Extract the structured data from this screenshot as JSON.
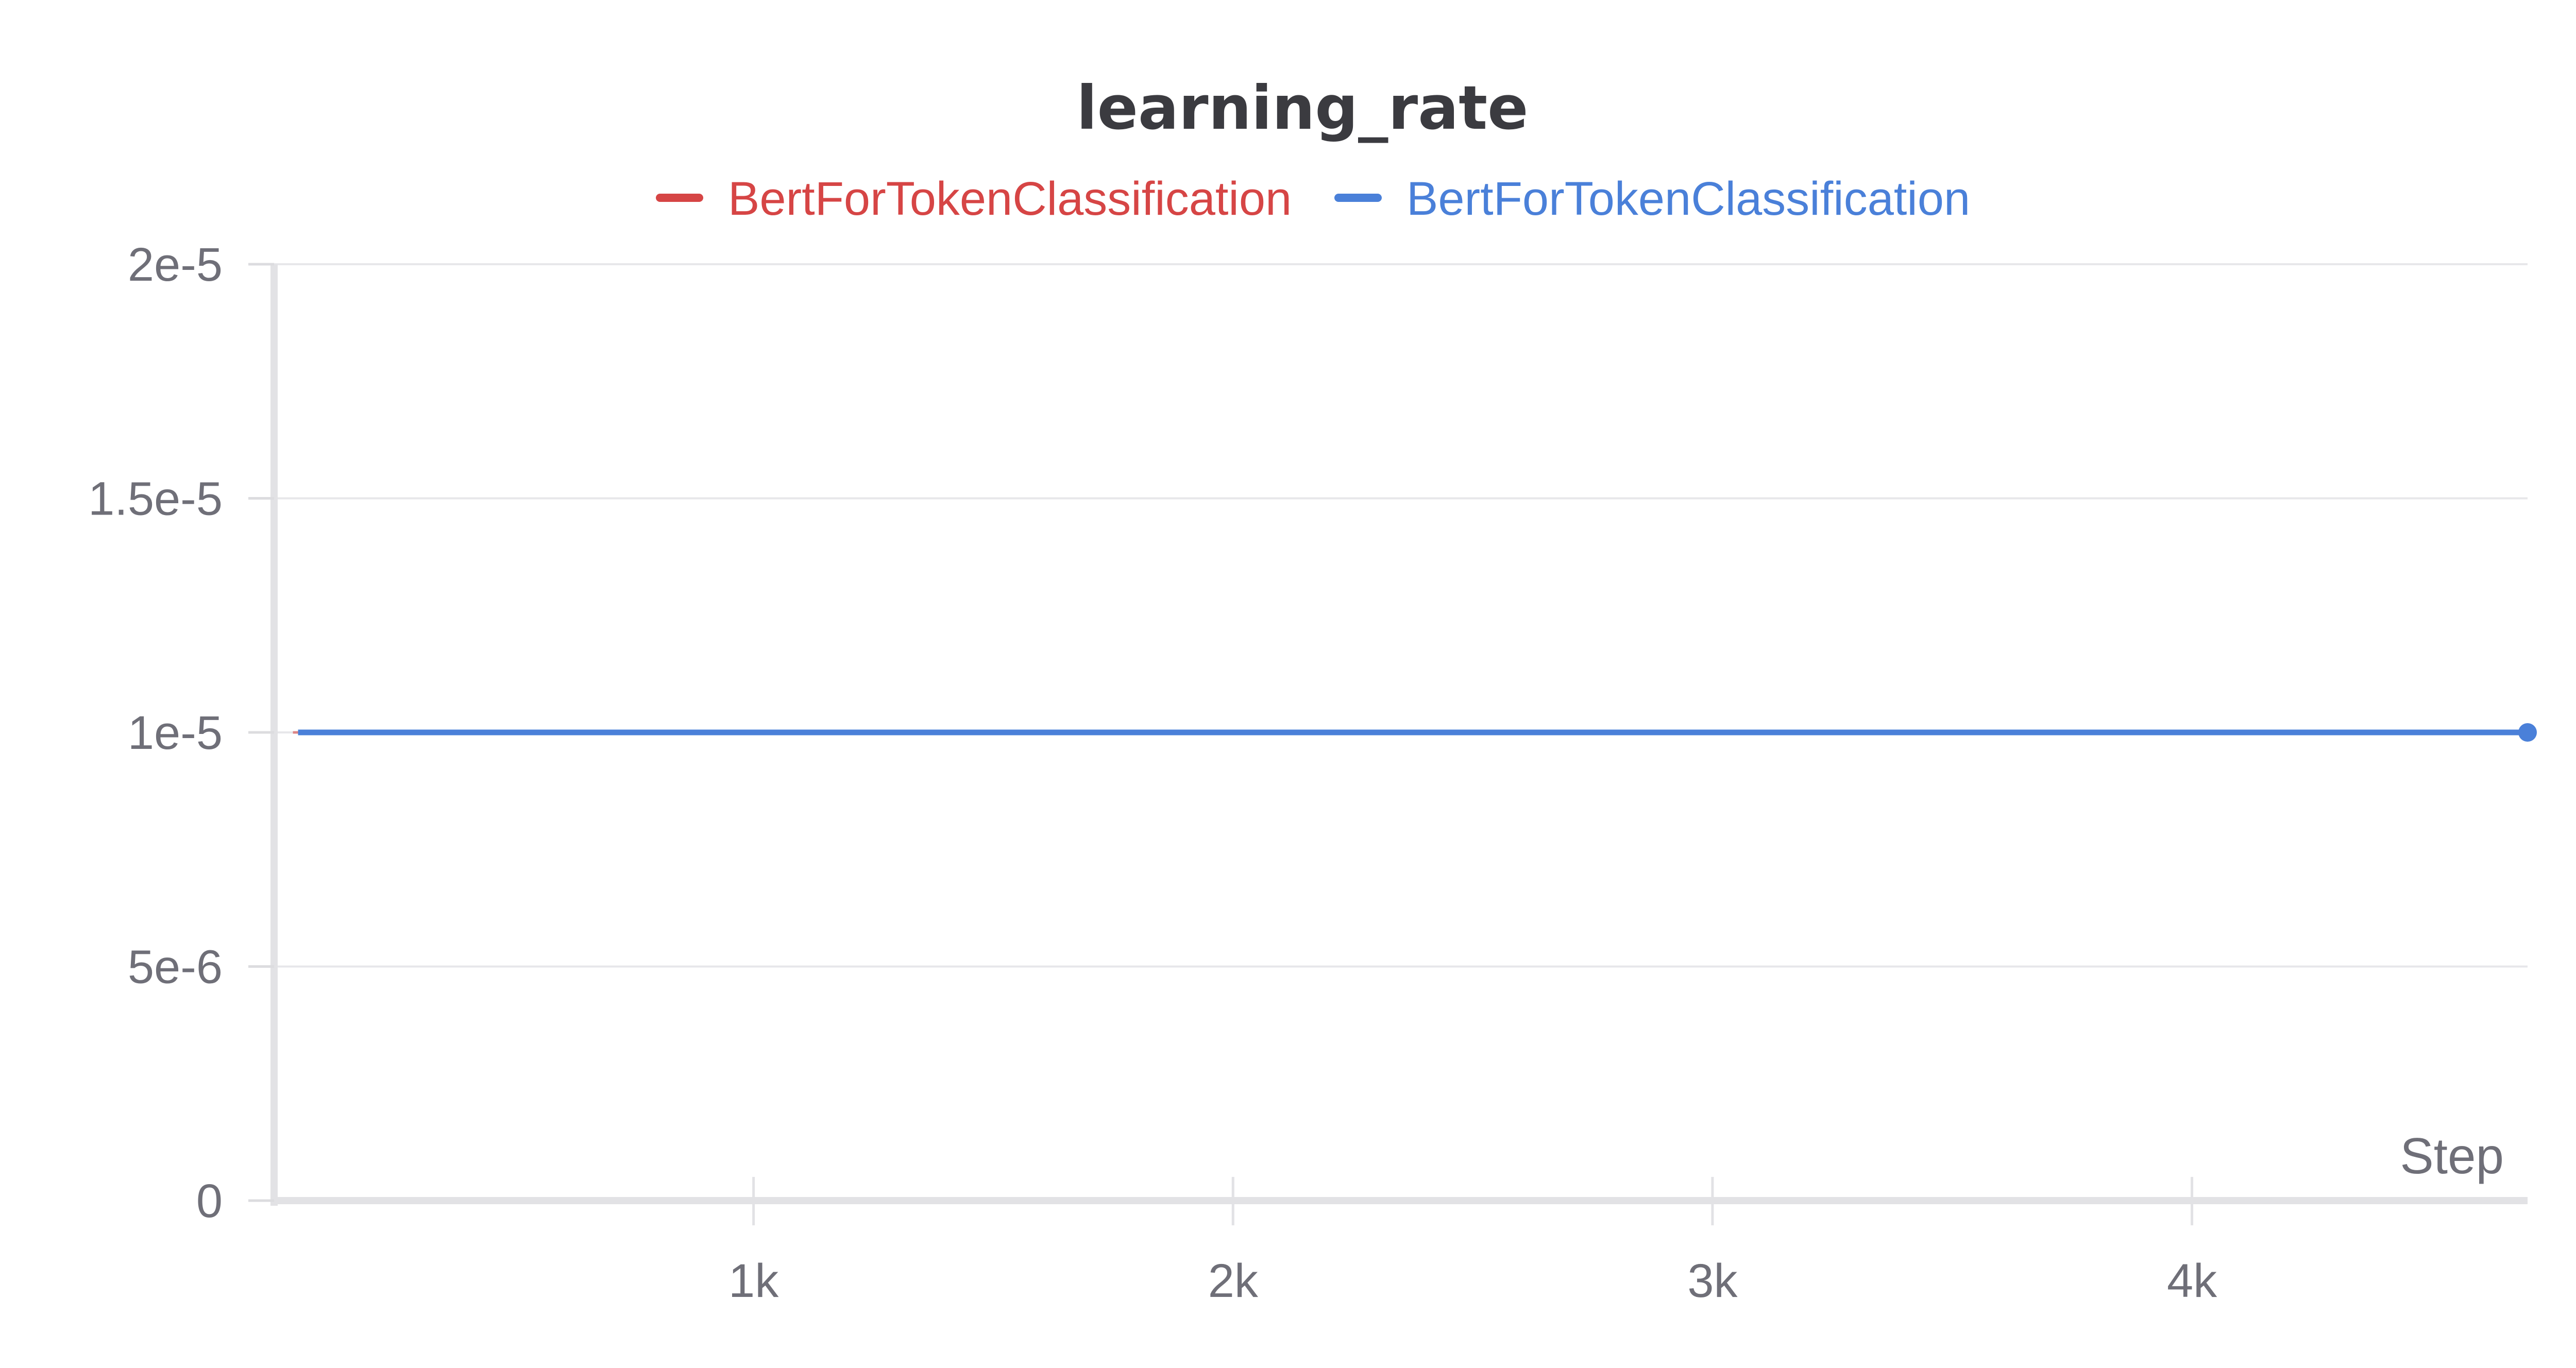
{
  "chart_data": {
    "type": "line",
    "title": "learning_rate",
    "xlabel": "Step",
    "ylabel": "",
    "xlim": [
      0,
      4700
    ],
    "ylim": [
      0,
      2e-05
    ],
    "x_ticks": [
      1000,
      2000,
      3000,
      4000
    ],
    "x_tick_labels": [
      "1k",
      "2k",
      "3k",
      "4k"
    ],
    "y_ticks": [
      0,
      5e-06,
      1e-05,
      1.5e-05,
      2e-05
    ],
    "y_tick_labels": [
      "0",
      "5e-6",
      "1e-5",
      "1.5e-5",
      "2e-5"
    ],
    "grid": true,
    "legend_position": "top-center",
    "series": [
      {
        "name": "BertForTokenClassification",
        "color": "#d64545",
        "x": [
          50
        ],
        "y": [
          1e-05
        ]
      },
      {
        "name": "BertForTokenClassification",
        "color": "#4a80d9",
        "x": [
          50,
          4700
        ],
        "y": [
          1e-05,
          1e-05
        ],
        "end_marker": true
      }
    ]
  }
}
